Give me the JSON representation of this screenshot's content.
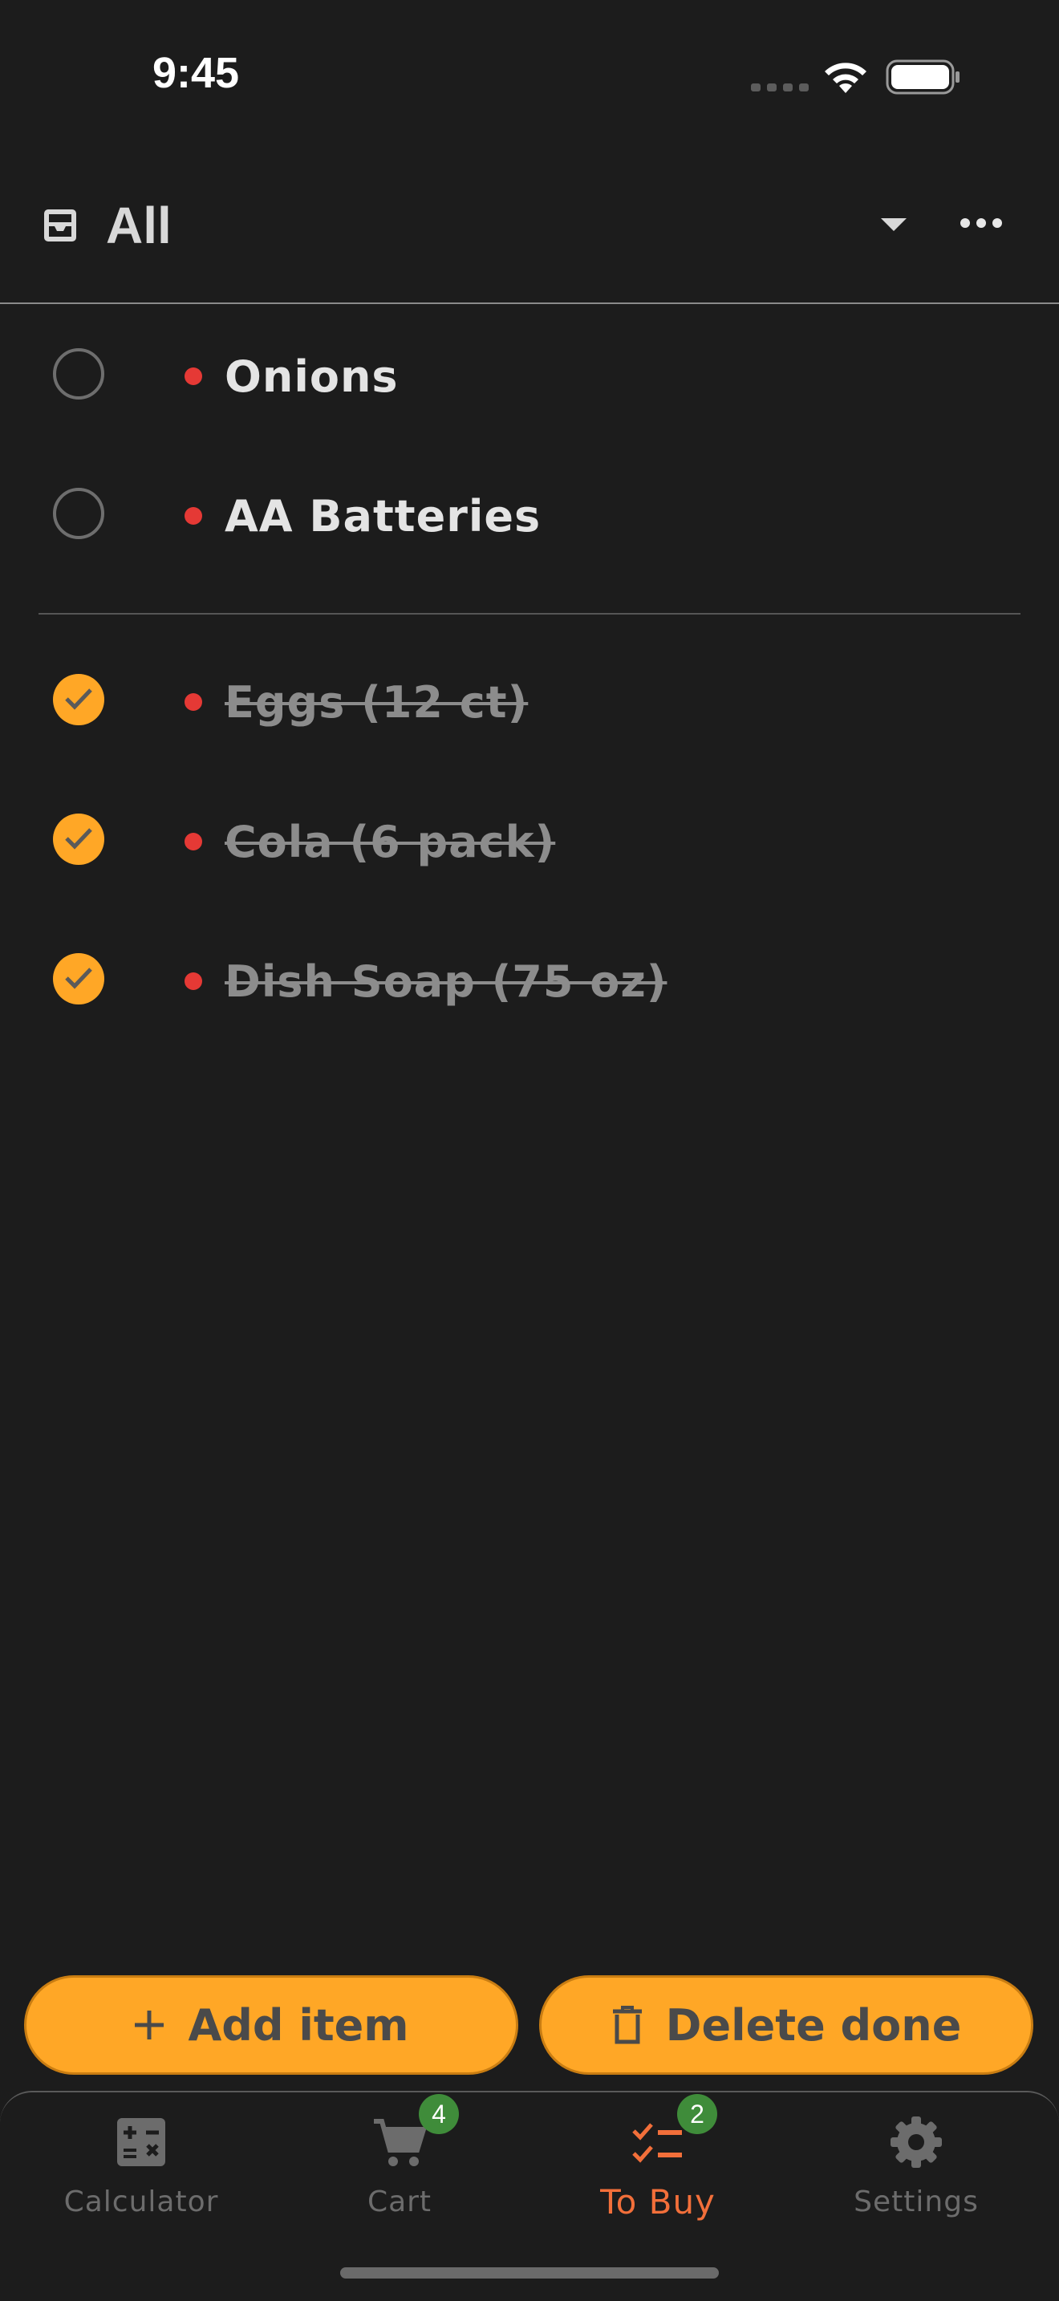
{
  "status_bar": {
    "time": "9:45",
    "icons": [
      "cellular-signal-icon",
      "wifi-icon",
      "battery-icon"
    ]
  },
  "header": {
    "title": "All",
    "icons": {
      "list": "inbox-tray-icon",
      "dropdown": "caret-down-icon",
      "menu": "more-horizontal-icon"
    }
  },
  "items": {
    "todo": [
      {
        "name": "Onions",
        "done": false
      },
      {
        "name": "AA Batteries",
        "done": false
      }
    ],
    "done": [
      {
        "name": "Eggs (12 ct)",
        "done": true
      },
      {
        "name": "Cola (6 pack)",
        "done": true
      },
      {
        "name": "Dish Soap (75 oz)",
        "done": true
      }
    ]
  },
  "actions": {
    "add_label": "Add item",
    "delete_label": "Delete done"
  },
  "bottom_nav": {
    "items": [
      {
        "label": "Calculator",
        "icon": "calculator-icon",
        "badge": null,
        "active": false
      },
      {
        "label": "Cart",
        "icon": "cart-icon",
        "badge": "4",
        "active": false
      },
      {
        "label": "To Buy",
        "icon": "checklist-icon",
        "badge": "2",
        "active": true
      },
      {
        "label": "Settings",
        "icon": "gear-icon",
        "badge": null,
        "active": false
      }
    ]
  },
  "colors": {
    "background": "#1c1c1c",
    "accent": "#ffa726",
    "active_tab": "#f26f3a",
    "priority": "#e53935",
    "badge": "#3f8c3a"
  }
}
